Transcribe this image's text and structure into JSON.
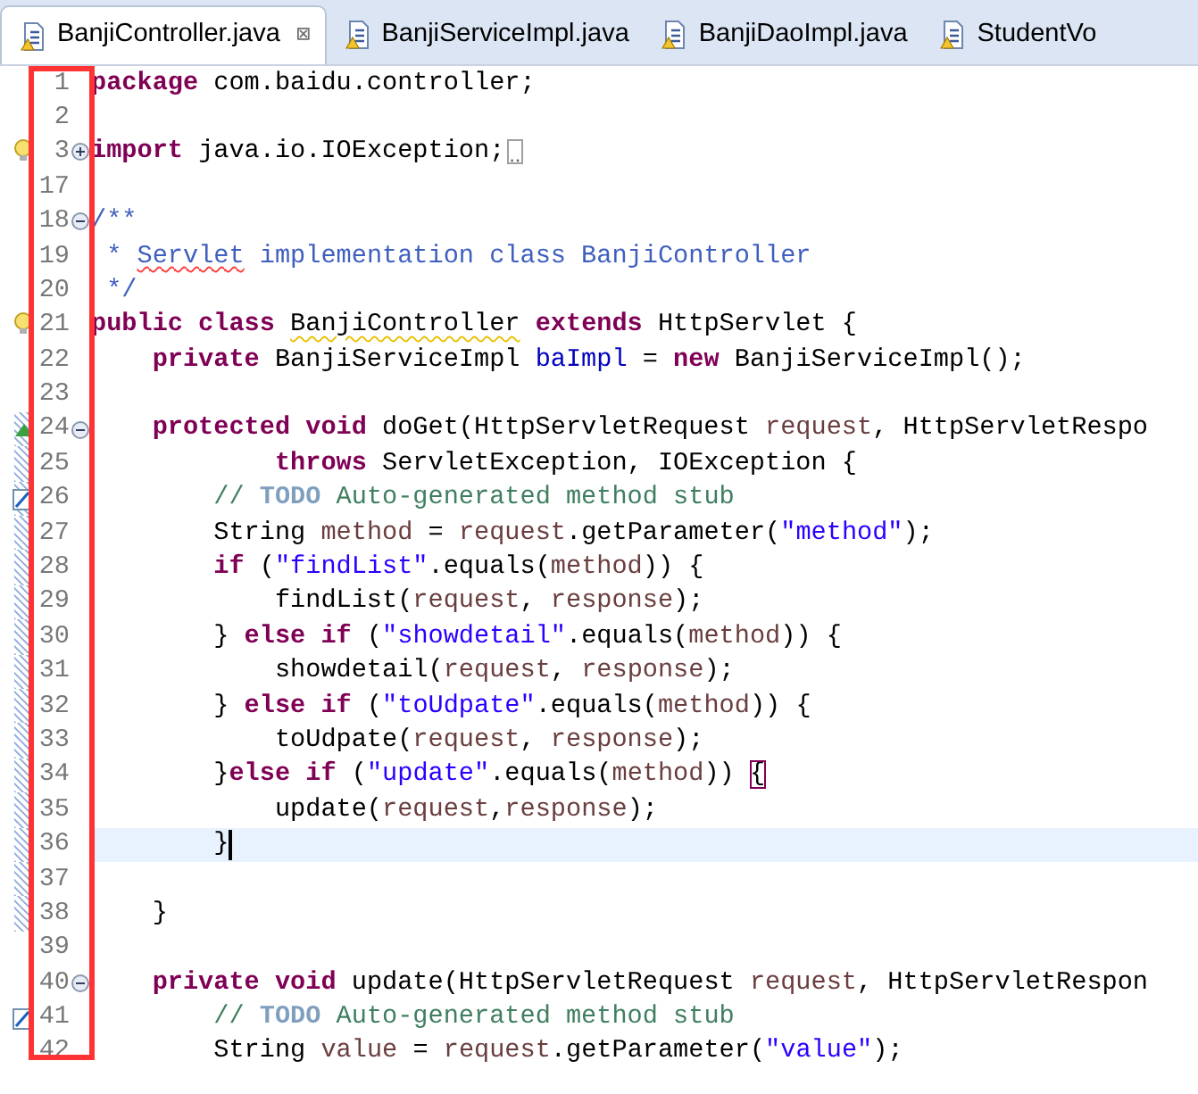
{
  "tabs": [
    {
      "label": "BanjiController.java",
      "selected": true,
      "close": "⊠"
    },
    {
      "label": "BanjiServiceImpl.java",
      "selected": false
    },
    {
      "label": "BanjiDaoImpl.java",
      "selected": false
    },
    {
      "label": "StudentVo",
      "selected": false
    }
  ],
  "editor": {
    "lines": [
      {
        "number": "1",
        "changed": false,
        "current": false,
        "tokens": [
          {
            "kind": "kw",
            "text": "package"
          },
          {
            "kind": "plain",
            "text": " com.baidu.controller;"
          }
        ]
      },
      {
        "number": "2",
        "changed": false,
        "current": false
      },
      {
        "number": "3",
        "changed": false,
        "current": false,
        "marker": {
          "kind": "warning"
        },
        "fold": {
          "kind": "collapsed"
        },
        "folded": true,
        "tokens": [
          {
            "kind": "kw",
            "text": "import"
          },
          {
            "kind": "plain",
            "text": " java.io.IOException;"
          }
        ]
      },
      {
        "number": "17",
        "changed": false,
        "current": false
      },
      {
        "number": "18",
        "changed": false,
        "current": false,
        "fold": {
          "kind": "expanded"
        },
        "tokens": [
          {
            "kind": "doc",
            "text": "/**"
          }
        ]
      },
      {
        "number": "19",
        "changed": false,
        "current": false,
        "tokens": [
          {
            "kind": "doc",
            "text": " * "
          },
          {
            "kind": "spell",
            "text": "Servlet"
          },
          {
            "kind": "doc",
            "text": " implementation class BanjiController"
          }
        ]
      },
      {
        "number": "20",
        "changed": false,
        "current": false,
        "tokens": [
          {
            "kind": "doc",
            "text": " */"
          }
        ]
      },
      {
        "number": "21",
        "changed": false,
        "current": false,
        "marker": {
          "kind": "warning"
        },
        "tokens": [
          {
            "kind": "kw",
            "text": "public class "
          },
          {
            "kind": "warn",
            "text": "BanjiController"
          },
          {
            "kind": "kw",
            "text": " extends"
          },
          {
            "kind": "plain",
            "text": " HttpServlet {"
          }
        ]
      },
      {
        "number": "22",
        "changed": false,
        "current": false,
        "tokens": [
          {
            "kind": "kw",
            "text": "    private"
          },
          {
            "kind": "plain",
            "text": " BanjiServiceImpl "
          },
          {
            "kind": "field",
            "text": "baImpl"
          },
          {
            "kind": "plain",
            "text": " = "
          },
          {
            "kind": "kw",
            "text": "new"
          },
          {
            "kind": "plain",
            "text": " BanjiServiceImpl();"
          }
        ]
      },
      {
        "number": "23",
        "changed": false,
        "current": false
      },
      {
        "number": "24",
        "changed": true,
        "current": false,
        "marker": {
          "kind": "override"
        },
        "fold": {
          "kind": "expanded"
        },
        "tokens": [
          {
            "kind": "kw",
            "text": "    protected void"
          },
          {
            "kind": "plain",
            "text": " doGet(HttpServletRequest "
          },
          {
            "kind": "param",
            "text": "request"
          },
          {
            "kind": "plain",
            "text": ", HttpServletRespo"
          }
        ]
      },
      {
        "number": "25",
        "changed": true,
        "current": false,
        "tokens": [
          {
            "kind": "kw",
            "text": "            throws"
          },
          {
            "kind": "plain",
            "text": " ServletException, IOException {"
          }
        ]
      },
      {
        "number": "26",
        "changed": true,
        "current": false,
        "marker": {
          "kind": "task"
        },
        "tokens": [
          {
            "kind": "comment",
            "text": "        // "
          },
          {
            "kind": "todo",
            "text": "TODO"
          },
          {
            "kind": "comment",
            "text": " Auto-generated method stub"
          }
        ]
      },
      {
        "number": "27",
        "changed": true,
        "current": false,
        "tokens": [
          {
            "kind": "plain",
            "text": "        String "
          },
          {
            "kind": "param",
            "text": "method"
          },
          {
            "kind": "plain",
            "text": " = "
          },
          {
            "kind": "param",
            "text": "request"
          },
          {
            "kind": "plain",
            "text": ".getParameter("
          },
          {
            "kind": "str",
            "text": "\"method\""
          },
          {
            "kind": "plain",
            "text": ");"
          }
        ]
      },
      {
        "number": "28",
        "changed": true,
        "current": false,
        "tokens": [
          {
            "kind": "kw",
            "text": "        if"
          },
          {
            "kind": "plain",
            "text": " ("
          },
          {
            "kind": "str",
            "text": "\"findList\""
          },
          {
            "kind": "plain",
            "text": ".equals("
          },
          {
            "kind": "param",
            "text": "method"
          },
          {
            "kind": "plain",
            "text": ")) {"
          }
        ]
      },
      {
        "number": "29",
        "changed": true,
        "current": false,
        "tokens": [
          {
            "kind": "plain",
            "text": "            findList("
          },
          {
            "kind": "param",
            "text": "request"
          },
          {
            "kind": "plain",
            "text": ", "
          },
          {
            "kind": "param",
            "text": "response"
          },
          {
            "kind": "plain",
            "text": ");"
          }
        ]
      },
      {
        "number": "30",
        "changed": true,
        "current": false,
        "tokens": [
          {
            "kind": "plain",
            "text": "        } "
          },
          {
            "kind": "kw",
            "text": "else if"
          },
          {
            "kind": "plain",
            "text": " ("
          },
          {
            "kind": "str",
            "text": "\"showdetail\""
          },
          {
            "kind": "plain",
            "text": ".equals("
          },
          {
            "kind": "param",
            "text": "method"
          },
          {
            "kind": "plain",
            "text": ")) {"
          }
        ]
      },
      {
        "number": "31",
        "changed": true,
        "current": false,
        "tokens": [
          {
            "kind": "plain",
            "text": "            showdetail("
          },
          {
            "kind": "param",
            "text": "request"
          },
          {
            "kind": "plain",
            "text": ", "
          },
          {
            "kind": "param",
            "text": "response"
          },
          {
            "kind": "plain",
            "text": ");"
          }
        ]
      },
      {
        "number": "32",
        "changed": true,
        "current": false,
        "tokens": [
          {
            "kind": "plain",
            "text": "        } "
          },
          {
            "kind": "kw",
            "text": "else if"
          },
          {
            "kind": "plain",
            "text": " ("
          },
          {
            "kind": "str",
            "text": "\"toUdpate\""
          },
          {
            "kind": "plain",
            "text": ".equals("
          },
          {
            "kind": "param",
            "text": "method"
          },
          {
            "kind": "plain",
            "text": ")) {"
          }
        ]
      },
      {
        "number": "33",
        "changed": true,
        "current": false,
        "tokens": [
          {
            "kind": "plain",
            "text": "            toUdpate("
          },
          {
            "kind": "param",
            "text": "request"
          },
          {
            "kind": "plain",
            "text": ", "
          },
          {
            "kind": "param",
            "text": "response"
          },
          {
            "kind": "plain",
            "text": ");"
          }
        ]
      },
      {
        "number": "34",
        "changed": true,
        "current": false,
        "tokens": [
          {
            "kind": "plain",
            "text": "        }"
          },
          {
            "kind": "kw",
            "text": "else if"
          },
          {
            "kind": "plain",
            "text": " ("
          },
          {
            "kind": "str",
            "text": "\"update\""
          },
          {
            "kind": "plain",
            "text": ".equals("
          },
          {
            "kind": "param",
            "text": "method"
          },
          {
            "kind": "plain",
            "text": ")) "
          },
          {
            "kind": "bracket",
            "text": "{"
          }
        ]
      },
      {
        "number": "35",
        "changed": true,
        "current": false,
        "tokens": [
          {
            "kind": "plain",
            "text": "            update("
          },
          {
            "kind": "param",
            "text": "request"
          },
          {
            "kind": "plain",
            "text": ","
          },
          {
            "kind": "param",
            "text": "response"
          },
          {
            "kind": "plain",
            "text": ");"
          }
        ]
      },
      {
        "number": "36",
        "changed": true,
        "current": true,
        "tokens": [
          {
            "kind": "plain",
            "text": "        }"
          }
        ]
      },
      {
        "number": "37",
        "changed": true,
        "current": false
      },
      {
        "number": "38",
        "changed": true,
        "current": false,
        "tokens": [
          {
            "kind": "plain",
            "text": "    }"
          }
        ]
      },
      {
        "number": "39",
        "changed": false,
        "current": false
      },
      {
        "number": "40",
        "changed": false,
        "current": false,
        "fold": {
          "kind": "expanded"
        },
        "tokens": [
          {
            "kind": "kw",
            "text": "    private void"
          },
          {
            "kind": "plain",
            "text": " update(HttpServletRequest "
          },
          {
            "kind": "param",
            "text": "request"
          },
          {
            "kind": "plain",
            "text": ", HttpServletRespon"
          }
        ]
      },
      {
        "number": "41",
        "changed": false,
        "current": false,
        "marker": {
          "kind": "task"
        },
        "tokens": [
          {
            "kind": "comment",
            "text": "        // "
          },
          {
            "kind": "todo",
            "text": "TODO"
          },
          {
            "kind": "comment",
            "text": " Auto-generated method stub"
          }
        ]
      },
      {
        "number": "42",
        "changed": false,
        "current": false,
        "tokens": [
          {
            "kind": "plain",
            "text": "        String "
          },
          {
            "kind": "param",
            "text": "value"
          },
          {
            "kind": "plain",
            "text": " = "
          },
          {
            "kind": "param",
            "text": "request"
          },
          {
            "kind": "plain",
            "text": ".getParameter("
          },
          {
            "kind": "str",
            "text": "\"value\""
          },
          {
            "kind": "plain",
            "text": ");"
          }
        ]
      }
    ]
  }
}
